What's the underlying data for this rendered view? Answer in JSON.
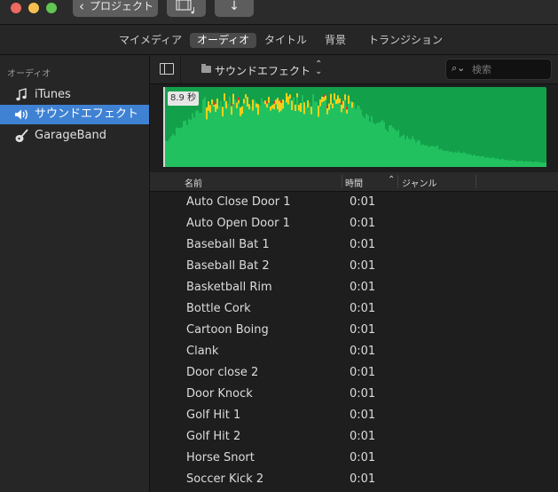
{
  "toolbar": {
    "back_label": "プロジェクト",
    "back_icon": "chevron-left-icon",
    "media_icon": "film-music-icon",
    "download_icon": "arrow-down-icon"
  },
  "tabs": [
    {
      "label": "マイメディア",
      "active": false
    },
    {
      "label": "オーディオ",
      "active": true
    },
    {
      "label": "タイトル",
      "active": false
    },
    {
      "label": "背景",
      "active": false
    },
    {
      "label": "トランジション",
      "active": false
    }
  ],
  "sidebar": {
    "header": "オーディオ",
    "items": [
      {
        "label": "iTunes",
        "icon": "music-note-icon"
      },
      {
        "label": "サウンドエフェクト",
        "icon": "speaker-icon",
        "selected": true
      },
      {
        "label": "GarageBand",
        "icon": "guitar-icon"
      }
    ]
  },
  "browser": {
    "location": "サウンドエフェクト",
    "search_placeholder": "検索",
    "duration_badge": "8.9 秒"
  },
  "colors": {
    "accent": "#3f82d4",
    "waveform": "#22c15f",
    "waveform_bg": "#13a04a",
    "peak": "#f0d01a",
    "clip": "#e03030"
  },
  "table": {
    "columns": {
      "name": "名前",
      "time": "時間",
      "genre": "ジャンル"
    },
    "rows": [
      {
        "name": "Auto Close Door 1",
        "time": "0:01"
      },
      {
        "name": "Auto Open Door 1",
        "time": "0:01"
      },
      {
        "name": "Baseball Bat 1",
        "time": "0:01"
      },
      {
        "name": "Baseball Bat 2",
        "time": "0:01"
      },
      {
        "name": "Basketball Rim",
        "time": "0:01"
      },
      {
        "name": "Bottle Cork",
        "time": "0:01"
      },
      {
        "name": "Cartoon Boing",
        "time": "0:01"
      },
      {
        "name": "Clank",
        "time": "0:01"
      },
      {
        "name": "Door close 2",
        "time": "0:01"
      },
      {
        "name": "Door Knock",
        "time": "0:01"
      },
      {
        "name": "Golf Hit 1",
        "time": "0:01"
      },
      {
        "name": "Golf Hit 2",
        "time": "0:01"
      },
      {
        "name": "Horse Snort",
        "time": "0:01"
      },
      {
        "name": "Soccer Kick 2",
        "time": "0:01"
      }
    ]
  }
}
